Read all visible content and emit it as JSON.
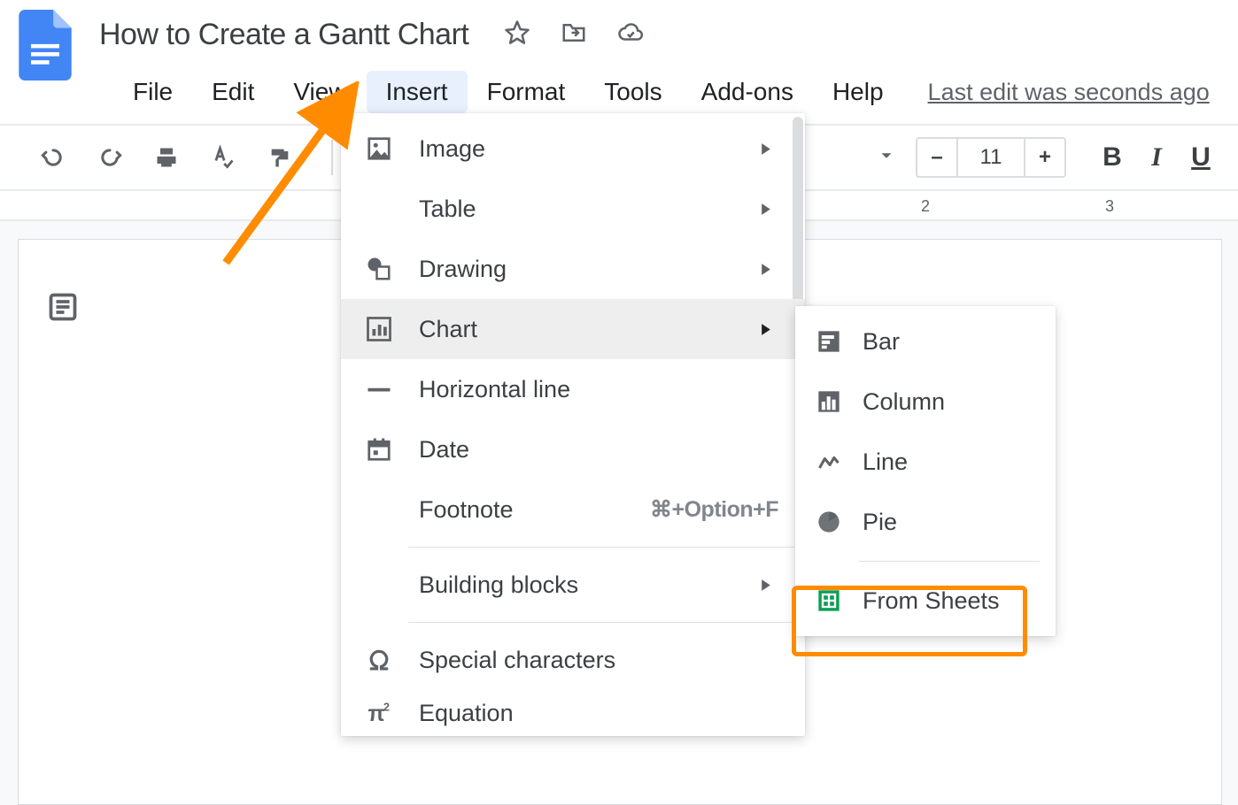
{
  "doc_title": "How to Create a Gantt Chart",
  "menubar": [
    "File",
    "Edit",
    "View",
    "Insert",
    "Format",
    "Tools",
    "Add-ons",
    "Help"
  ],
  "menubar_active_index": 3,
  "last_edit": "Last edit was seconds ago",
  "toolbar": {
    "font_size": "11",
    "bold": "B",
    "italic": "I",
    "underline": "U",
    "minus": "–",
    "plus": "+"
  },
  "ruler": {
    "ticks": [
      "2",
      "3"
    ]
  },
  "insert_menu": {
    "items": [
      {
        "label": "Image",
        "icon": "image",
        "submenu": true
      },
      {
        "label": "Table",
        "icon": "",
        "submenu": true
      },
      {
        "label": "Drawing",
        "icon": "drawing",
        "submenu": true
      },
      {
        "label": "Chart",
        "icon": "chart",
        "submenu": true,
        "active": true
      },
      {
        "label": "Horizontal line",
        "icon": "hline",
        "submenu": false
      },
      {
        "label": "Date",
        "icon": "date",
        "submenu": false
      },
      {
        "label": "Footnote",
        "icon": "",
        "submenu": false,
        "shortcut": "⌘+Option+F"
      },
      {
        "divider": true
      },
      {
        "label": "Building blocks",
        "icon": "",
        "submenu": true
      },
      {
        "divider": true
      },
      {
        "label": "Special characters",
        "icon": "omega",
        "submenu": false
      },
      {
        "label": "Equation",
        "icon": "pi",
        "submenu": false
      }
    ]
  },
  "chart_submenu": {
    "items": [
      {
        "label": "Bar",
        "icon": "bar"
      },
      {
        "label": "Column",
        "icon": "column"
      },
      {
        "label": "Line",
        "icon": "line"
      },
      {
        "label": "Pie",
        "icon": "pie"
      },
      {
        "divider": true
      },
      {
        "label": "From Sheets",
        "icon": "sheets",
        "highlighted": true
      }
    ]
  }
}
